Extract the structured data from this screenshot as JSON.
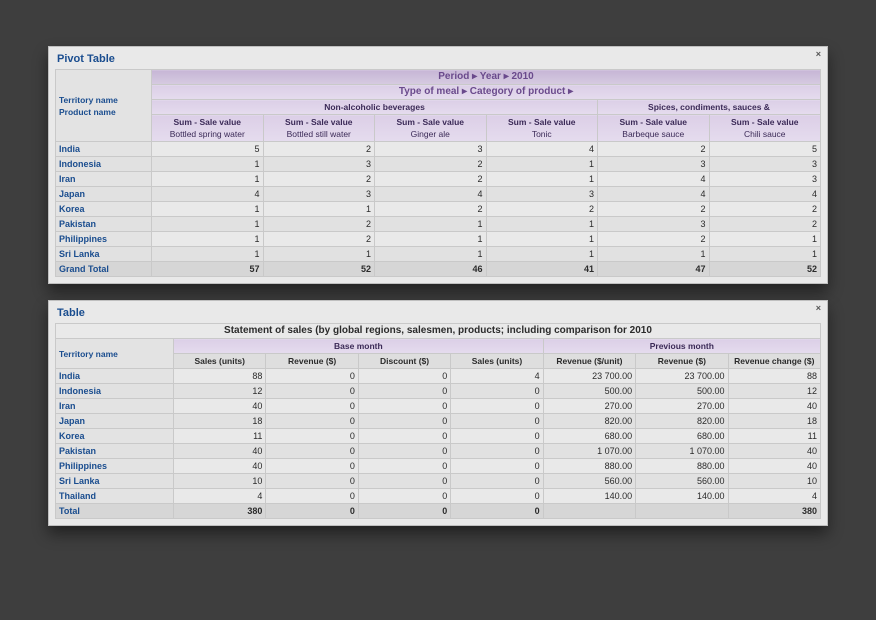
{
  "panel1": {
    "title": "Pivot Table",
    "close": "×",
    "supertitle": "Period ▸ Year ▸ 2010",
    "supersub": "Type of meal ▸ Category of product ▸",
    "groupA": "Non-alcoholic beverages",
    "groupB": "Spices, condiments, sauces &",
    "cornerA": "Territory name",
    "cornerB": "Product name",
    "sub0": "Sum - Sale value",
    "cols": [
      "Bottled spring water",
      "Bottled still water",
      "Ginger ale",
      "Tonic",
      "Barbeque sauce",
      "Chili sauce"
    ],
    "rows": [
      [
        "India",
        "5",
        "2",
        "3",
        "4",
        "2",
        "5"
      ],
      [
        "Indonesia",
        "1",
        "3",
        "2",
        "1",
        "3",
        "3"
      ],
      [
        "Iran",
        "1",
        "2",
        "2",
        "1",
        "4",
        "3"
      ],
      [
        "Japan",
        "4",
        "3",
        "4",
        "3",
        "4",
        "4"
      ],
      [
        "Korea",
        "1",
        "1",
        "2",
        "2",
        "2",
        "2"
      ],
      [
        "Pakistan",
        "1",
        "2",
        "1",
        "1",
        "3",
        "2"
      ],
      [
        "Philippines",
        "1",
        "2",
        "1",
        "1",
        "2",
        "1"
      ],
      [
        "Sri Lanka",
        "1",
        "1",
        "1",
        "1",
        "1",
        "1"
      ]
    ],
    "totalLabel": "Grand Total",
    "totals": [
      "57",
      "52",
      "46",
      "41",
      "47",
      "52"
    ]
  },
  "panel2": {
    "title": "Table",
    "close": "×",
    "caption": "Statement of sales (by global regions, salesmen, products; including comparison for 2010",
    "groupA": "Base month",
    "groupB": "Previous month",
    "cornerA": "Territory name",
    "headers": [
      "Sales (units)",
      "Revenue ($)",
      "Discount ($)",
      "Sales (units)",
      "Revenue ($/unit)",
      "Revenue ($)",
      "Revenue change ($)"
    ],
    "rows": [
      [
        "India",
        "88",
        "0",
        "0",
        "4",
        "23 700.00",
        "23 700.00",
        "88"
      ],
      [
        "Indonesia",
        "12",
        "0",
        "0",
        "0",
        "500.00",
        "500.00",
        "12"
      ],
      [
        "Iran",
        "40",
        "0",
        "0",
        "0",
        "270.00",
        "270.00",
        "40"
      ],
      [
        "Japan",
        "18",
        "0",
        "0",
        "0",
        "820.00",
        "820.00",
        "18"
      ],
      [
        "Korea",
        "11",
        "0",
        "0",
        "0",
        "680.00",
        "680.00",
        "11"
      ],
      [
        "Pakistan",
        "40",
        "0",
        "0",
        "0",
        "1 070.00",
        "1 070.00",
        "40"
      ],
      [
        "Philippines",
        "40",
        "0",
        "0",
        "0",
        "880.00",
        "880.00",
        "40"
      ],
      [
        "Sri Lanka",
        "10",
        "0",
        "0",
        "0",
        "560.00",
        "560.00",
        "10"
      ],
      [
        "Thailand",
        "4",
        "0",
        "0",
        "0",
        "140.00",
        "140.00",
        "4"
      ]
    ],
    "totalLabel": "Total",
    "totals": [
      "380",
      "0",
      "0",
      "0",
      "",
      "",
      "380"
    ]
  }
}
